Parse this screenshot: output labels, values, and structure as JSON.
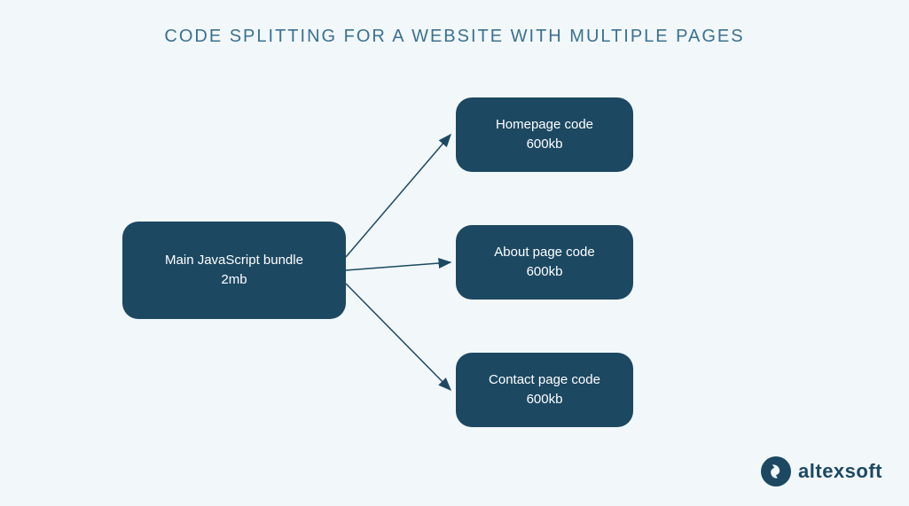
{
  "title": "CODE SPLITTING FOR A WEBSITE WITH MULTIPLE PAGES",
  "main": {
    "label": "Main JavaScript bundle",
    "size": "2mb"
  },
  "pages": [
    {
      "label": "Homepage code",
      "size": "600kb"
    },
    {
      "label": "About page code",
      "size": "600kb"
    },
    {
      "label": "Contact page code",
      "size": "600kb"
    }
  ],
  "brand": "altexsoft"
}
